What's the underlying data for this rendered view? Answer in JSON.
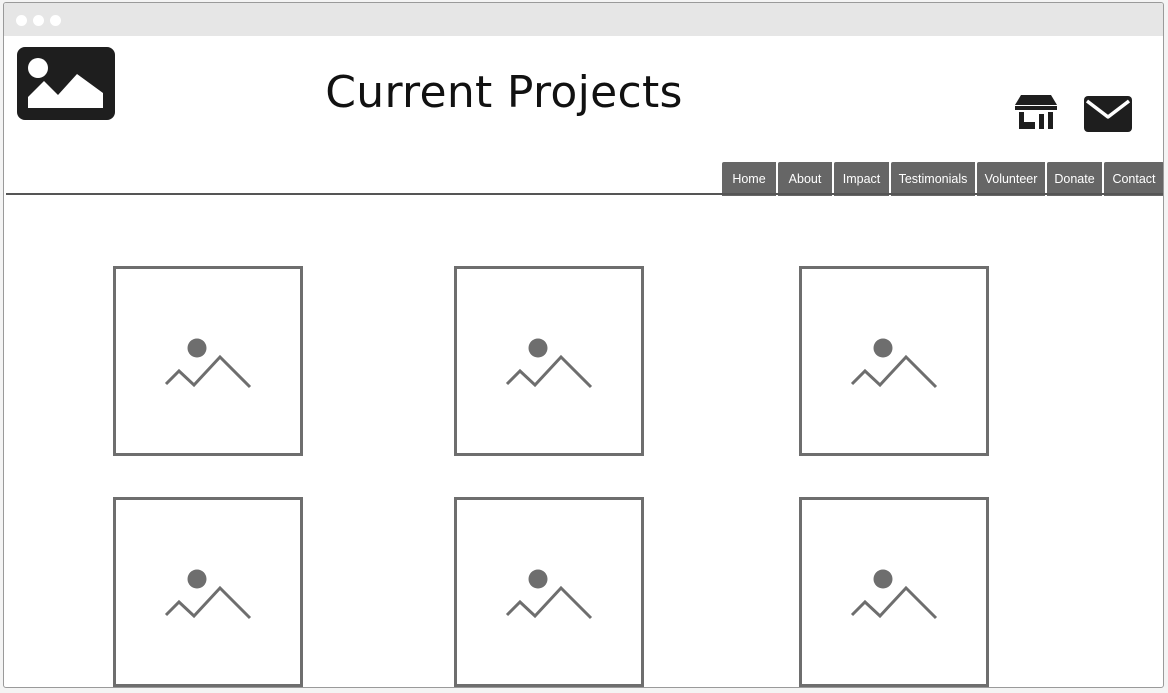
{
  "header": {
    "title": "Current Projects",
    "logo_icon": "image-placeholder-icon",
    "shop_icon": "storefront-icon",
    "mail_icon": "envelope-icon"
  },
  "nav": {
    "items": [
      {
        "label": "Home"
      },
      {
        "label": "About"
      },
      {
        "label": "Impact"
      },
      {
        "label": "Testimonials"
      },
      {
        "label": "Volunteer"
      },
      {
        "label": "Donate"
      },
      {
        "label": "Contact"
      }
    ]
  },
  "projects": {
    "thumbnail_icon": "image-placeholder-icon",
    "count": 6
  },
  "colors": {
    "nav_bg": "#666666",
    "nav_text": "#ffffff",
    "icon_dark": "#1e1e1e",
    "placeholder_gray": "#6e6e6e",
    "titlebar": "#e6e6e6"
  }
}
